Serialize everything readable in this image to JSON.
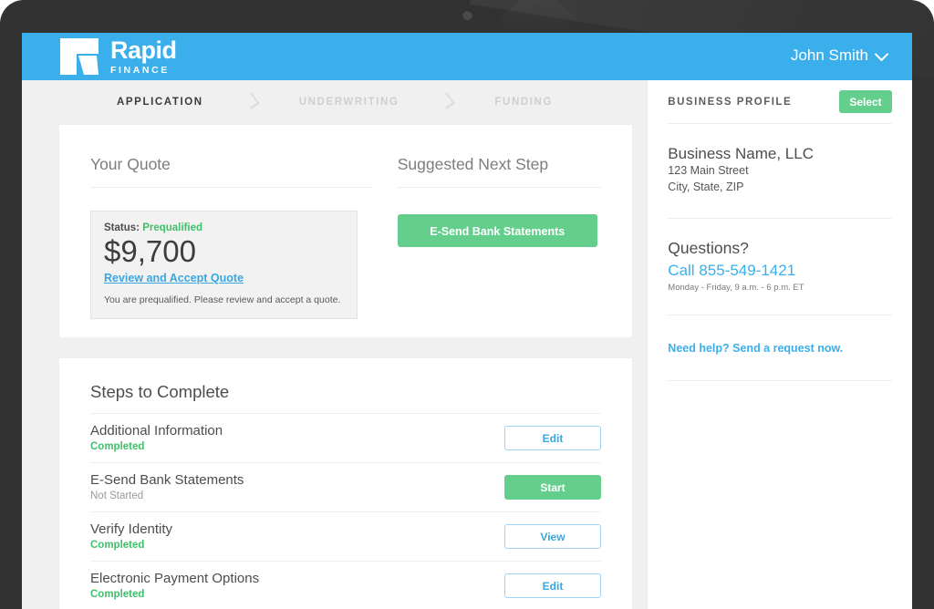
{
  "brand": {
    "logo_icon": "rapid-r-logomark",
    "name": "Rapid",
    "tagline": "FINANCE",
    "accent_blue": "#3bafec",
    "accent_green": "#64ce8c",
    "link_blue": "#3ba7e0"
  },
  "header": {
    "user_name": "John Smith",
    "chevron_icon": "chevron-down-icon"
  },
  "progress": {
    "steps": [
      {
        "label": "APPLICATION",
        "state": "active"
      },
      {
        "label": "UNDERWRITING",
        "state": "inactive"
      },
      {
        "label": "FUNDING",
        "state": "inactive"
      }
    ],
    "separator_icon": "chevron-right-icon"
  },
  "quote": {
    "section_title": "Your Quote",
    "status_label": "Status:",
    "status_value": "Prequalified",
    "amount": "$9,700",
    "link": "Review and Accept Quote",
    "note": "You are prequalified. Please review and accept a quote."
  },
  "next_step": {
    "section_title": "Suggested Next Step",
    "button_label": "E-Send Bank Statements"
  },
  "steps_to_complete": {
    "title": "Steps to Complete",
    "rows": [
      {
        "name": "Additional Information",
        "status": "Completed",
        "status_kind": "completed",
        "action": "Edit",
        "action_kind": "outline"
      },
      {
        "name": "E-Send Bank Statements",
        "status": "Not Started",
        "status_kind": "notstarted",
        "action": "Start",
        "action_kind": "solid"
      },
      {
        "name": "Verify Identity",
        "status": "Completed",
        "status_kind": "completed",
        "action": "View",
        "action_kind": "outline"
      },
      {
        "name": "Electronic Payment Options",
        "status": "Completed",
        "status_kind": "completed",
        "action": "Edit",
        "action_kind": "outline"
      }
    ]
  },
  "sidebar": {
    "profile_heading": "BUSINESS PROFILE",
    "select_label": "Select",
    "business_name": "Business Name, LLC",
    "address_line1": "123 Main Street",
    "address_line2": "City, State, ZIP",
    "questions_title": "Questions?",
    "phone": "Call 855-549-1421",
    "hours": "Monday - Friday, 9 a.m. - 6 p.m. ET",
    "help_link": "Need help? Send a request now."
  }
}
